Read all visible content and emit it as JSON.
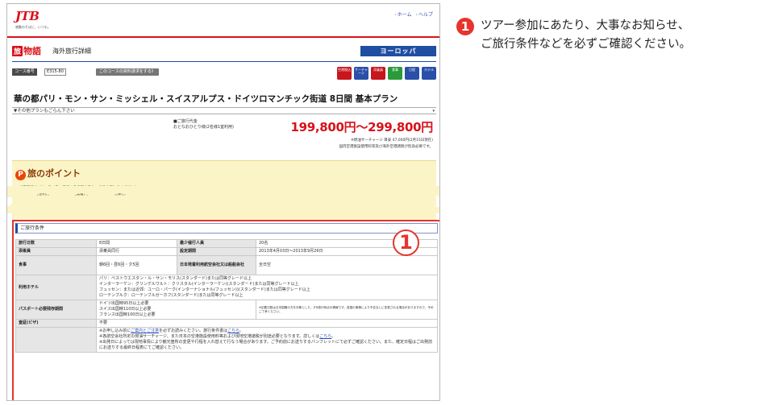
{
  "header": {
    "logo": "JTB",
    "tagline": "感動のそばに、いつも。",
    "links": [
      "ホーム",
      "ヘルプ"
    ]
  },
  "brand": {
    "mark": "旅",
    "mark_rest": "物語",
    "title": "海外旅行詳細",
    "region": "ヨーロッパ"
  },
  "course": {
    "code_label": "コース番号",
    "code": "E315-80",
    "request_button": "このコースの資料請求をする》",
    "icons": [
      {
        "name": "airport-tax-icon",
        "label": "空港税込",
        "color": "#c8161d"
      },
      {
        "name": "surcharge-icon",
        "label": "サーチャージ",
        "color": "#2a4fa8"
      },
      {
        "name": "guide-icon",
        "label": "添乗員",
        "color": "#c8161d"
      },
      {
        "name": "meal-icon",
        "label": "食事",
        "color": "#2a9a3a"
      },
      {
        "name": "schedule-icon",
        "label": "日程",
        "color": "#2a4fa8"
      },
      {
        "name": "hotel-icon",
        "label": "ホテル",
        "color": "#2a4fa8"
      }
    ],
    "title": "華の都パリ・モン・サン・ミッシェル・スイスアルプス・ドイツロマンチック街道 8日間 基本プラン",
    "other_plans": "▼その他プランもごらん下さい",
    "price_label": "■ご旅行代金",
    "price_sub": "おとなおひとり様(2名様1室利用)",
    "price": "199,800円～299,800円",
    "surcharge": "※燃油サーチャージ 目安 47,000円(2月15日現在)",
    "surcharge_note": "国内空港施設使用料等及び海外空港諸税が別途必要です。"
  },
  "points": {
    "badge": "P",
    "heading": "旅のポイント",
    "lines": [
      "・8日間でドイツ、スイス、フランスの魅力をたっぷりお楽しみください!",
      "・全日空直行便利用(羽田または成田発着)で快適な空の旅をお楽しみいただけます。"
    ]
  },
  "conditions": {
    "heading": "ご旅行条件",
    "callout": "1",
    "rows": {
      "days_label": "旅行日数",
      "days": "8日間",
      "min_label": "最少催行人員",
      "min": "20名",
      "guide_label": "添乗員",
      "guide": "添乗員同行",
      "period_label": "設定期間",
      "period": "2013年4月03日～2013年9月26日",
      "meal_label": "食事",
      "meal": "朝6回・昼6回・夕5回",
      "airline_label": "日本発着利用航空会社又は船舶会社",
      "airline": "全日空",
      "hotel_label": "利用ホテル",
      "hotels": [
        "パリ：ベストウエスタン・ル・サン・モリス(スタンダード)または同等グレード以上",
        "インターラーケン：グリンデルワルト：クリスタル(インターラーケン)(スタンダード)または同等グレード以上",
        "フュッセン：または近郊：ユーロ・パーク(インターナショナル(フュッセン))(スタンダード)または同等グレード以上",
        "ローテンブルク：ローテンブルガーホフ(スタンダード)または同等グレード以上"
      ],
      "passport_label": "パスポート必要残存期間",
      "passport": [
        "ドイツ出国時95日以上必要",
        "スイス出国時110日以上必要",
        "フランス出国時100日以上必要"
      ],
      "passport_note": "※記載日数は日本国籍の方を対象とした、JTB旅行時点の情報です。各国の事情により予告なしに変更される場合がありますので、予めご了承ください。",
      "visa_label": "査証(ビザ)",
      "visa": "不要",
      "notes_1a": "※お申し込み前に",
      "notes_1_link": "ご案内とご注意",
      "notes_1b": "を必ずお読みください。旅行条件書は",
      "notes_1_link2": "こちら",
      "notes_1c": "。",
      "notes_2a": "※各航空会社所定の燃油サーチャージ、また日本の空港施設使用料等および現地空港諸税が別途必要となります。詳しくは",
      "notes_2_link": "こちら",
      "notes_2b": "。",
      "notes_3": "※出発日によっては現地事情により観光箇所の変更や行程を入れ替えて行なう場合があります。ご予約前にお送りするパンフレットにて必ずご確認ください。また、確定日程はご出発前にお送りする最終日程表にてご確認ください。"
    }
  },
  "annotation": {
    "number": "1",
    "line1": "ツアー参加にあたり、大事なお知らせ、",
    "line2": "ご旅行条件などを必ずご確認ください。"
  }
}
